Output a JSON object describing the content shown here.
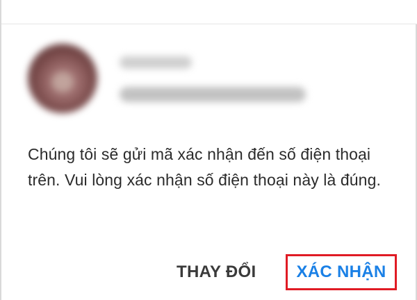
{
  "dialog": {
    "account": {
      "avatar": "user-avatar",
      "name_hidden": true,
      "phone_hidden": true
    },
    "message": "Chúng tôi sẽ gửi mã xác nhận đến số điện thoại trên. Vui lòng xác nhận số điện thoại này là đúng.",
    "buttons": {
      "change_label": "THAY ĐỔI",
      "confirm_label": "XÁC NHẬN"
    }
  },
  "colors": {
    "confirm_text": "#1a80e6",
    "highlight_border": "#e01b24",
    "change_text": "#3a3a3a",
    "body_text": "#2b2b2b"
  }
}
